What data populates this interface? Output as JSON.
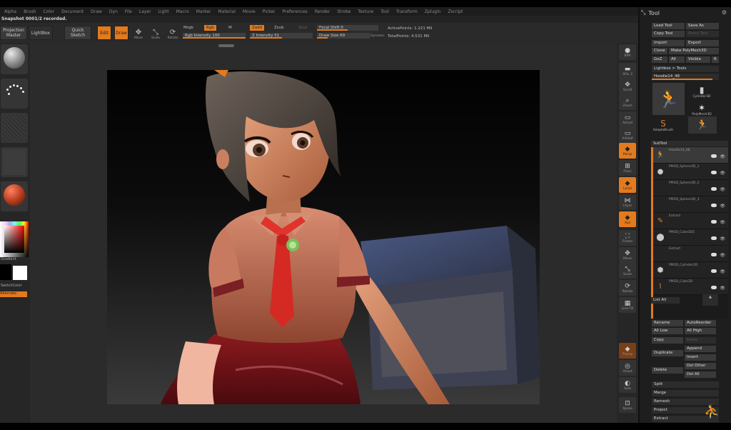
{
  "menubar": {
    "items": [
      "Alpha",
      "Brush",
      "Color",
      "Document",
      "Draw",
      "Dyn",
      "File",
      "Layer",
      "Light",
      "Macro",
      "Marker",
      "Material",
      "Movie",
      "Picker",
      "Preferences",
      "Render",
      "Stroke",
      "Texture",
      "Tool",
      "Transform",
      "Zplugin",
      "Zscript"
    ]
  },
  "undo_history": "Snapshot 0001/2 recorded.",
  "toolbar": {
    "projection_master": "Projection Master",
    "lightbox": "LightBox",
    "quick_sketch": "Quick Sketch",
    "edit": "Edit",
    "draw": "Draw",
    "move": "Move",
    "scale": "Scale",
    "rotate": "Rotate",
    "mrgb": "Mrgb",
    "rgb": "Rgb",
    "m": "M",
    "zadd": "Zadd",
    "zsub": "Zsub",
    "zcut": "Zcut",
    "rgb_intensity": "Rgb Intensity 100",
    "z_intensity": "Z Intensity 51",
    "focal_shift": "Focal Shift 0",
    "draw_size": "Draw Size 69",
    "dynamic": "Dynamic",
    "active_points": "ActivePoints: 1.221 Mil",
    "total_points": "TotalPoints: 4.531 Mil"
  },
  "left_shelf": {
    "gradient_label": "Gradient",
    "switch_color": "SwitchColor",
    "alternate": "Alternate"
  },
  "right_shelf": {
    "buttons": [
      "BPR",
      "SPix 3",
      "Scroll",
      "Zoom",
      "Actual",
      "AAHalf",
      "Persp",
      "Floor",
      "Local",
      "LSym",
      "Xyz",
      "Frame",
      "Move",
      "Scale",
      "Rotate",
      "Line Fill",
      "Transp",
      "Ghost",
      "Solo",
      "Xpose"
    ]
  },
  "tool_panel": {
    "title": "Tool",
    "load_tool": "Load Tool",
    "save_as": "Save As",
    "copy_tool": "Copy Tool",
    "paste_tool": "Paste Tool",
    "import": "Import",
    "export": "Export",
    "clone": "Clone",
    "make_polymesh": "Make PolyMesh3D",
    "goz": "GoZ",
    "all": "All",
    "visible": "Visible",
    "r": "R",
    "lightbox_tools": "Lightbox > Tools",
    "current_tool": "Hoodie14_48",
    "tool_slots": [
      "Cylinder3D",
      "PolyMesh3D",
      "SimpleBrush"
    ],
    "subtool_header": "SubTool",
    "subtools": [
      {
        "name": "Hoodie14_48"
      },
      {
        "name": "PM3D_Sphere3D_1"
      },
      {
        "name": "PM3D_Sphere3D_2"
      },
      {
        "name": "PM3D_Sphere3D_3"
      },
      {
        "name": "Extract"
      },
      {
        "name": "PM3D_Cube3D1"
      },
      {
        "name": "Extract"
      },
      {
        "name": "PM3D_Cylinder3D"
      },
      {
        "name": "PM3D_Cube3D"
      }
    ],
    "list_all": "List All",
    "rename": "Rename",
    "auto_reorder": "AutoReorder",
    "all_low": "All Low",
    "all_high": "All High",
    "copy": "Copy",
    "paste": "Paste",
    "append": "Append",
    "duplicate": "Duplicate",
    "insert": "Insert",
    "delete": "Delete",
    "del_other": "Del Other",
    "del_all": "Del All",
    "split": "Split",
    "merge": "Merge",
    "remesh": "Remesh",
    "project": "Project",
    "extract": "Extract"
  },
  "colors": {
    "accent": "#e27a1e",
    "panel_bg": "#1e1e1e",
    "viewport_bg": "#2b2b2b"
  }
}
